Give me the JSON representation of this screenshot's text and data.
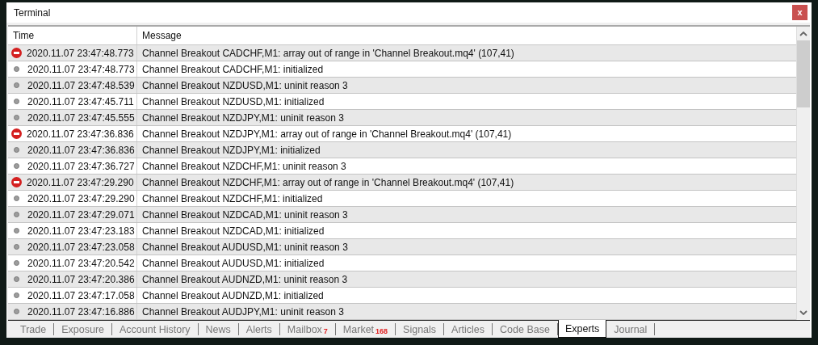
{
  "window": {
    "title": "Terminal",
    "close": "x"
  },
  "table": {
    "columns": [
      "Time",
      "Message"
    ],
    "rows": [
      {
        "kind": "error",
        "time": "2020.11.07 23:47:48.773",
        "message": "Channel Breakout CADCHF,M1: array out of range in 'Channel Breakout.mq4' (107,41)"
      },
      {
        "kind": "info",
        "time": "2020.11.07 23:47:48.773",
        "message": "Channel Breakout CADCHF,M1: initialized"
      },
      {
        "kind": "info",
        "time": "2020.11.07 23:47:48.539",
        "message": "Channel Breakout NZDUSD,M1: uninit reason 3"
      },
      {
        "kind": "info",
        "time": "2020.11.07 23:47:45.711",
        "message": "Channel Breakout NZDUSD,M1: initialized"
      },
      {
        "kind": "info",
        "time": "2020.11.07 23:47:45.555",
        "message": "Channel Breakout NZDJPY,M1: uninit reason 3"
      },
      {
        "kind": "error",
        "time": "2020.11.07 23:47:36.836",
        "message": "Channel Breakout NZDJPY,M1: array out of range in 'Channel Breakout.mq4' (107,41)"
      },
      {
        "kind": "info",
        "time": "2020.11.07 23:47:36.836",
        "message": "Channel Breakout NZDJPY,M1: initialized"
      },
      {
        "kind": "info",
        "time": "2020.11.07 23:47:36.727",
        "message": "Channel Breakout NZDCHF,M1: uninit reason 3"
      },
      {
        "kind": "error",
        "time": "2020.11.07 23:47:29.290",
        "message": "Channel Breakout NZDCHF,M1: array out of range in 'Channel Breakout.mq4' (107,41)"
      },
      {
        "kind": "info",
        "time": "2020.11.07 23:47:29.290",
        "message": "Channel Breakout NZDCHF,M1: initialized"
      },
      {
        "kind": "info",
        "time": "2020.11.07 23:47:29.071",
        "message": "Channel Breakout NZDCAD,M1: uninit reason 3"
      },
      {
        "kind": "info",
        "time": "2020.11.07 23:47:23.183",
        "message": "Channel Breakout NZDCAD,M1: initialized"
      },
      {
        "kind": "info",
        "time": "2020.11.07 23:47:23.058",
        "message": "Channel Breakout AUDUSD,M1: uninit reason 3"
      },
      {
        "kind": "info",
        "time": "2020.11.07 23:47:20.542",
        "message": "Channel Breakout AUDUSD,M1: initialized"
      },
      {
        "kind": "info",
        "time": "2020.11.07 23:47:20.386",
        "message": "Channel Breakout AUDNZD,M1: uninit reason 3"
      },
      {
        "kind": "info",
        "time": "2020.11.07 23:47:17.058",
        "message": "Channel Breakout AUDNZD,M1: initialized"
      },
      {
        "kind": "info",
        "time": "2020.11.07 23:47:16.886",
        "message": "Channel Breakout AUDJPY,M1: uninit reason 3"
      }
    ]
  },
  "tabs": [
    {
      "label": "Trade",
      "selected": false
    },
    {
      "label": "Exposure",
      "selected": false
    },
    {
      "label": "Account History",
      "selected": false
    },
    {
      "label": "News",
      "selected": false
    },
    {
      "label": "Alerts",
      "selected": false
    },
    {
      "label": "Mailbox",
      "badge": "7",
      "selected": false
    },
    {
      "label": "Market",
      "badge": "168",
      "selected": false
    },
    {
      "label": "Signals",
      "selected": false
    },
    {
      "label": "Articles",
      "selected": false
    },
    {
      "label": "Code Base",
      "selected": false
    },
    {
      "label": "Experts",
      "selected": true
    },
    {
      "label": "Journal",
      "selected": false
    }
  ]
}
